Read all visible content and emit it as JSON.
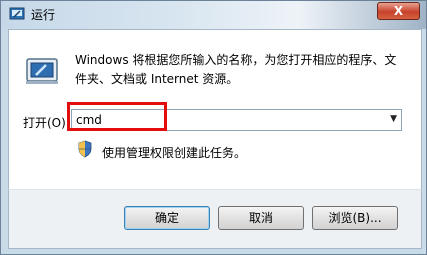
{
  "window": {
    "title": "运行",
    "close_glyph": "X"
  },
  "description": "Windows 将根据您所输入的名称，为您打开相应的程序、文件夹、文档或 Internet 资源。",
  "open_field": {
    "label": "打开(O):",
    "value": "cmd"
  },
  "admin_note": "使用管理权限创建此任务。",
  "buttons": {
    "ok": "确定",
    "cancel": "取消",
    "browse": "浏览(B)..."
  },
  "colors": {
    "highlight": "#e30d0d",
    "accent": "#3c7fb1"
  },
  "icons": [
    "run-icon",
    "shield-icon",
    "dropdown-arrow-icon",
    "close-icon"
  ]
}
